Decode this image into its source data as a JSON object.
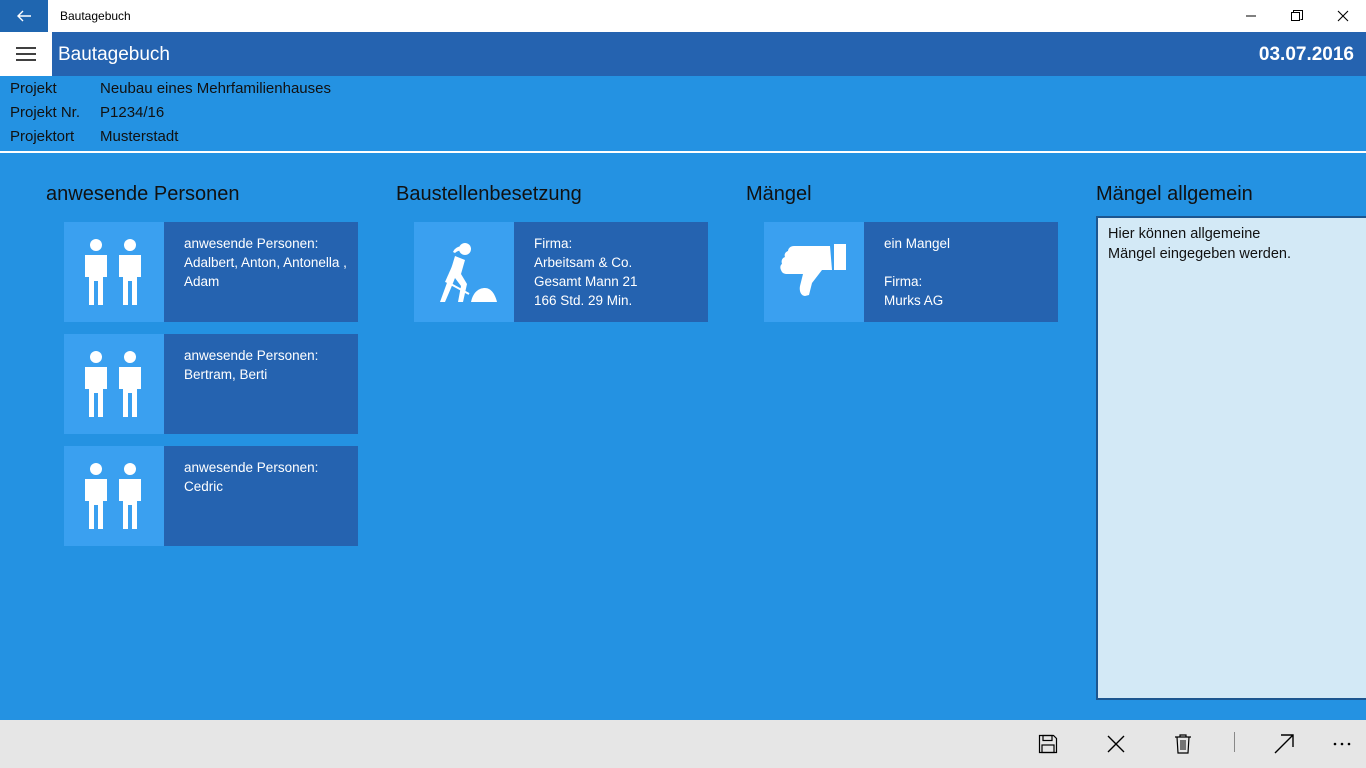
{
  "window": {
    "title": "Bautagebuch",
    "back_icon": "arrow-left-icon"
  },
  "header": {
    "title": "Bautagebuch",
    "date": "03.07.2016"
  },
  "project": {
    "rows": [
      {
        "label": "Projekt",
        "value": "Neubau eines Mehrfamilienhauses"
      },
      {
        "label": "Projekt Nr.",
        "value": "P1234/16"
      },
      {
        "label": "Projektort",
        "value": "Musterstadt"
      }
    ]
  },
  "sections": {
    "personen": {
      "title": "anwesende Personen",
      "tiles": [
        {
          "heading": "anwesende Personen:",
          "line1": "Adalbert, Anton, Antonella ,",
          "line2": "Adam"
        },
        {
          "heading": "anwesende Personen:",
          "line1": "Bertram, Berti",
          "line2": ""
        },
        {
          "heading": "anwesende Personen:",
          "line1": "Cedric",
          "line2": ""
        }
      ]
    },
    "besetzung": {
      "title": "Baustellenbesetzung",
      "tiles": [
        {
          "line1": "Firma:",
          "line2": "Arbeitsam & Co.",
          "line3": "Gesamt Mann 21",
          "line4": "166 Std. 29 Min."
        }
      ]
    },
    "maengel": {
      "title": "Mängel",
      "tiles": [
        {
          "line1": "ein Mangel",
          "line2": "",
          "line3": "Firma:",
          "line4": "Murks AG"
        }
      ]
    },
    "allgemein": {
      "title": "Mängel allgemein",
      "text_line1": "Hier können allgemeine",
      "text_line2": "Mängel eingegeben werden."
    }
  },
  "colors": {
    "background": "#2492e2",
    "appbar": "#2563b0",
    "tile": "#2563b0",
    "tile_icon": "#3aa0f0",
    "textarea": "#d3e9f6",
    "commandbar": "#e6e6e6"
  },
  "commands": [
    "save-icon",
    "close-icon",
    "delete-icon",
    "share-arrow-icon",
    "more-icon"
  ]
}
